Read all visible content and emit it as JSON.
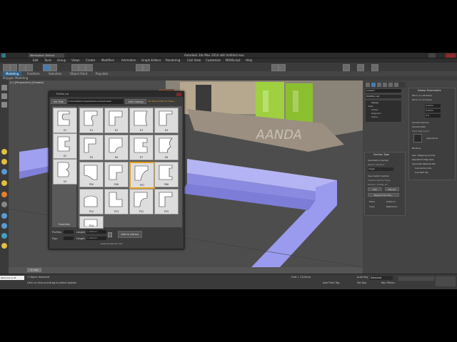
{
  "window": {
    "title": "Autodesk 3ds Max 2014 x64  Untitled.max",
    "workspace": "Workspace: Default"
  },
  "menu": {
    "items": [
      "Edit",
      "Tools",
      "Group",
      "Views",
      "Create",
      "Modifiers",
      "Animation",
      "Graph Editors",
      "Rendering",
      "Civil View",
      "Customize",
      "MAXScript",
      "Help"
    ]
  },
  "ribbon": {
    "tabs": [
      "Modeling",
      "Freeform",
      "Selection",
      "Object Paint",
      "Populate"
    ],
    "subtitle": "Polygon Modeling"
  },
  "viewport": {
    "label": "[+] [Perspective] [Shaded]"
  },
  "dialog": {
    "title": "Profile Lib",
    "set_path": "Set Path",
    "path": "C:\\Users\\Benlin\\AppData\\Local\\Autodesk",
    "add_catalog": "Add Catalog",
    "set_new": "Set New Profile for Tessa",
    "favorites": "Favorites",
    "left_thumbs": [
      "01",
      "02",
      "03"
    ],
    "grid": [
      "E1",
      "E2",
      "E3",
      "E4",
      "E5",
      "E6",
      "E7",
      "E8",
      "P05",
      "P06",
      "P07",
      "P08",
      "P12",
      "P13",
      "P22",
      "P23",
      "P14"
    ],
    "profiles_label": "Profiles",
    "profiles_value": "",
    "pipe_label": "Pipe",
    "length_label": "Length",
    "length_value": "1.000mm",
    "height_label": "Height",
    "height_value": "1.000mm",
    "add_library": "Add to Library",
    "website": "www.3d-kstudio.com"
  },
  "command_panel": {
    "object_name": "Line007",
    "modifier_list": "Modifier List",
    "stack": [
      "Sweep",
      "Line",
      "Vertex",
      "Segment",
      "Spline"
    ],
    "section_type": "Section Type",
    "use_builtin": "Use Built-In Section",
    "builtin_label": "Built-In Section:",
    "builtin_value": "Angle",
    "use_custom": "Use Custom Section",
    "custom_label": "Custom Section Type",
    "section_name": "Section: Profile_07",
    "pick": "Pick",
    "extract": "Extract",
    "merge": "Merge From File...",
    "move": "Move",
    "instance": "Instance",
    "copy": "Copy",
    "reference": "Reference",
    "params_title": "Sweep Parameters",
    "mirror_xz": "Mirror on XZ Plane",
    "mirror_xy": "Mirror on XY Plane",
    "x_offset": "0.0mm",
    "y_offset": "0.0mm",
    "angle": "0.0",
    "smooth_section": "Smooth Section",
    "smooth_path": "Smooth Path",
    "pivot_alignment": "Pivot Alignment",
    "align_pivot": "Align Pivot",
    "banking": "Banking",
    "gen_mapping": "Gen. Mapping Coords",
    "real_world": "Real-World Map Size",
    "gen_mat": "Generate Material IDs",
    "use_section_ids": "Use Section IDs",
    "use_path_ids": "Use Path IDs"
  },
  "timeline": {
    "frame": "0 / 100"
  },
  "status": {
    "left": "1 Object Selected",
    "hint": "Click or click-and-drag to select objects",
    "maxscript": "Welcome to M",
    "grid": "Grid = 10.0mm",
    "autokey": "Auto Key",
    "selected": "Selected",
    "setkey": "Set Key",
    "keyfilters": "Key Filters...",
    "addtime": "Add Time Tag"
  },
  "colors": {
    "accent": "#e0a020",
    "sweep": "#9a9aee",
    "door": "#9fd040"
  }
}
